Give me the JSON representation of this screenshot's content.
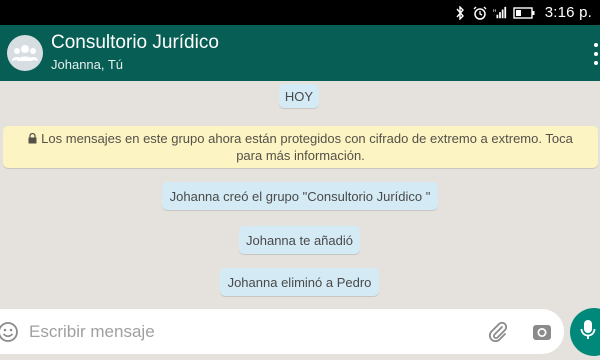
{
  "status_bar": {
    "time": "3:16 p.",
    "icons": [
      "bluetooth-icon",
      "alarm-icon",
      "signal-icon",
      "battery-icon"
    ]
  },
  "header": {
    "title": "Consultorio Jurídico",
    "subtitle": "Johanna, Tú",
    "color": "#075e54"
  },
  "chat": {
    "date_label": "HOY",
    "encryption_notice": "Los mensajes en este grupo ahora están protegidos con cifrado de extremo a extremo. Toca para más información.",
    "system_messages": [
      "Johanna creó el grupo \"Consultorio Jurídico \"",
      "Johanna te añadió",
      "Johanna eliminó a Pedro"
    ]
  },
  "composer": {
    "placeholder": "Escribir mensaje",
    "value": "",
    "send_color": "#00897b"
  }
}
